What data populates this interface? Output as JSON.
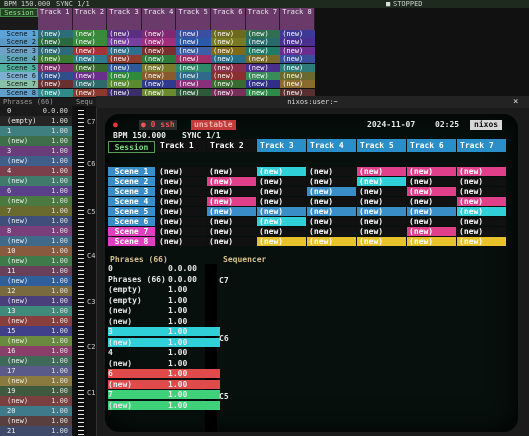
{
  "topbar": {
    "bpm": "BPM 150.000",
    "sync": "SYNC 1/1",
    "status_icon": "stop-square-icon",
    "status": "STOPPED"
  },
  "session_tab": "Session",
  "tracks": [
    "Track 1",
    "Track 2",
    "Track 3",
    "Track 4",
    "Track 5",
    "Track 6",
    "Track 7",
    "Track 8"
  ],
  "scenes": [
    "Scene 1",
    "Scene 2",
    "Scene 3",
    "Scene 4",
    "Scene 5",
    "Scene 6",
    "Scene 7",
    "Scene 8"
  ],
  "clip_label": "(new)",
  "phrases": {
    "title": "Phrases (66)",
    "rows": [
      {
        "label": "0",
        "value": "0.0.00"
      },
      {
        "label": "(empty)",
        "value": "1.00"
      },
      {
        "label": "1",
        "value": "1.00"
      },
      {
        "label": "(new)",
        "value": "1.00"
      },
      {
        "label": "3",
        "value": "1.00"
      },
      {
        "label": "(new)",
        "value": "1.00"
      },
      {
        "label": "4",
        "value": "1.00"
      },
      {
        "label": "(new)",
        "value": "1.00"
      },
      {
        "label": "6",
        "value": "1.00"
      },
      {
        "label": "(new)",
        "value": "1.00"
      },
      {
        "label": "7",
        "value": "1.00"
      },
      {
        "label": "(new)",
        "value": "1.00"
      },
      {
        "label": "8",
        "value": "1.00"
      },
      {
        "label": "(new)",
        "value": "1.00"
      },
      {
        "label": "10",
        "value": "1.00"
      },
      {
        "label": "(new)",
        "value": "1.00"
      },
      {
        "label": "11",
        "value": "1.00"
      },
      {
        "label": "(new)",
        "value": "1.00"
      },
      {
        "label": "12",
        "value": "1.00"
      },
      {
        "label": "(new)",
        "value": "1.00"
      },
      {
        "label": "13",
        "value": "1.00"
      },
      {
        "label": "(new)",
        "value": "1.00"
      },
      {
        "label": "15",
        "value": "1.00"
      },
      {
        "label": "(new)",
        "value": "1.00"
      },
      {
        "label": "16",
        "value": "1.00"
      },
      {
        "label": "(new)",
        "value": "1.00"
      },
      {
        "label": "17",
        "value": "1.00"
      },
      {
        "label": "(new)",
        "value": "1.00"
      },
      {
        "label": "19",
        "value": "1.00"
      },
      {
        "label": "(new)",
        "value": "1.00"
      },
      {
        "label": "20",
        "value": "1.00"
      },
      {
        "label": "(new)",
        "value": "1.00"
      },
      {
        "label": "21",
        "value": "1.00"
      }
    ]
  },
  "sequencer": {
    "title": "Sequ",
    "notes": [
      "C7",
      "C6",
      "C5",
      "C4",
      "C3",
      "C2",
      "C1"
    ]
  },
  "terminal": {
    "title": "nixos:user:~",
    "close": "×",
    "screen": {
      "indicator": "●",
      "ssh_tab": "● 0 ssh",
      "tab2": "unstable",
      "datetime": "2024-11-07",
      "clock": "02:25",
      "host": "nixos",
      "bpm": "BPM 150.000",
      "sync": "SYNC 1/1",
      "session_tab": "Session",
      "phrases_title": "Phrases (66)",
      "sequencer_title": "Sequencer",
      "notes": [
        "C7",
        "C6",
        "C5"
      ],
      "prows": [
        {
          "label": "0",
          "value": "0.0.00"
        },
        {
          "label": "Phrases (66)",
          "value": "0.0.00"
        },
        {
          "label": "(empty)",
          "value": "1.00"
        },
        {
          "label": "(empty)",
          "value": "1.00"
        },
        {
          "label": "(new)",
          "value": "1.00"
        },
        {
          "label": "(new)",
          "value": "1.00"
        },
        {
          "label": "3",
          "value": "1.00"
        },
        {
          "label": "(new)",
          "value": "1.00"
        },
        {
          "label": "4",
          "value": "1.00"
        },
        {
          "label": "(new)",
          "value": "1.00"
        },
        {
          "label": "6",
          "value": "1.00"
        },
        {
          "label": "(new)",
          "value": "1.00"
        },
        {
          "label": "7",
          "value": "1.00"
        },
        {
          "label": "(new)",
          "value": "1.00"
        }
      ]
    }
  }
}
